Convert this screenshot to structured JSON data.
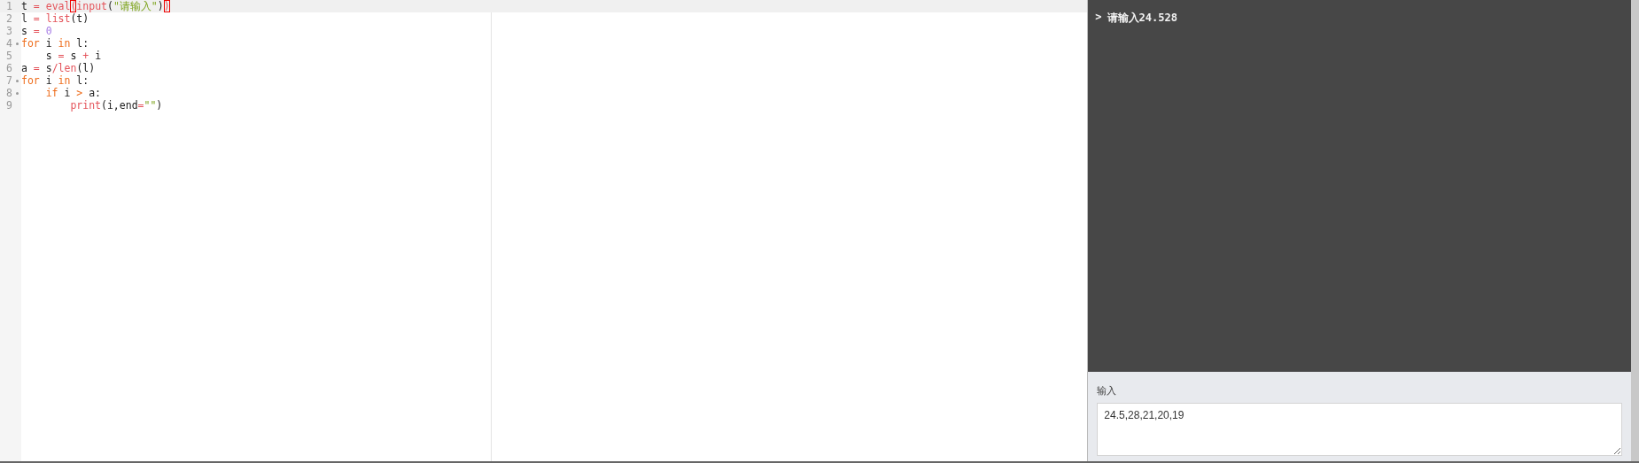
{
  "editor": {
    "lines": [
      {
        "number": "1",
        "foldable": false,
        "active": true,
        "tokens": [
          {
            "kind": "plain",
            "text": "t "
          },
          {
            "kind": "op",
            "text": "="
          },
          {
            "kind": "builtin",
            "text": " eval"
          },
          {
            "kind": "bracket",
            "text": "("
          },
          {
            "kind": "builtin",
            "text": "input"
          },
          {
            "kind": "plain",
            "text": "("
          },
          {
            "kind": "string",
            "text": "\"请输入\""
          },
          {
            "kind": "plain",
            "text": ")"
          },
          {
            "kind": "bracket",
            "text": ")"
          }
        ]
      },
      {
        "number": "2",
        "foldable": false,
        "active": false,
        "tokens": [
          {
            "kind": "plain",
            "text": "l "
          },
          {
            "kind": "op",
            "text": "="
          },
          {
            "kind": "builtin",
            "text": " list"
          },
          {
            "kind": "plain",
            "text": "(t)"
          }
        ]
      },
      {
        "number": "3",
        "foldable": false,
        "active": false,
        "tokens": [
          {
            "kind": "plain",
            "text": "s "
          },
          {
            "kind": "op",
            "text": "="
          },
          {
            "kind": "number",
            "text": " 0"
          }
        ]
      },
      {
        "number": "4",
        "foldable": true,
        "active": false,
        "tokens": [
          {
            "kind": "keyword",
            "text": "for"
          },
          {
            "kind": "plain",
            "text": " i "
          },
          {
            "kind": "keyword",
            "text": "in"
          },
          {
            "kind": "plain",
            "text": " l:"
          }
        ]
      },
      {
        "number": "5",
        "foldable": false,
        "active": false,
        "tokens": [
          {
            "kind": "plain",
            "text": "    s "
          },
          {
            "kind": "op",
            "text": "="
          },
          {
            "kind": "plain",
            "text": " s "
          },
          {
            "kind": "op",
            "text": "+"
          },
          {
            "kind": "plain",
            "text": " i"
          }
        ]
      },
      {
        "number": "6",
        "foldable": false,
        "active": false,
        "tokens": [
          {
            "kind": "plain",
            "text": "a "
          },
          {
            "kind": "op",
            "text": "="
          },
          {
            "kind": "plain",
            "text": " s"
          },
          {
            "kind": "op",
            "text": "/"
          },
          {
            "kind": "builtin",
            "text": "len"
          },
          {
            "kind": "plain",
            "text": "(l)"
          }
        ]
      },
      {
        "number": "7",
        "foldable": true,
        "active": false,
        "tokens": [
          {
            "kind": "keyword",
            "text": "for"
          },
          {
            "kind": "plain",
            "text": " i "
          },
          {
            "kind": "keyword",
            "text": "in"
          },
          {
            "kind": "plain",
            "text": " l:"
          }
        ]
      },
      {
        "number": "8",
        "foldable": true,
        "active": false,
        "tokens": [
          {
            "kind": "keyword",
            "text": "    if"
          },
          {
            "kind": "plain",
            "text": " i "
          },
          {
            "kind": "keyword",
            "text": ">"
          },
          {
            "kind": "plain",
            "text": " a:"
          }
        ]
      },
      {
        "number": "9",
        "foldable": false,
        "active": false,
        "tokens": [
          {
            "kind": "builtin",
            "text": "        print"
          },
          {
            "kind": "plain",
            "text": "(i,end"
          },
          {
            "kind": "op",
            "text": "="
          },
          {
            "kind": "string",
            "text": "\"\""
          },
          {
            "kind": "plain",
            "text": ")"
          }
        ]
      }
    ]
  },
  "console": {
    "prompt": ">",
    "output": "请输入24.528"
  },
  "input_panel": {
    "label": "输入",
    "value": "24.5,28,21,20,19"
  }
}
